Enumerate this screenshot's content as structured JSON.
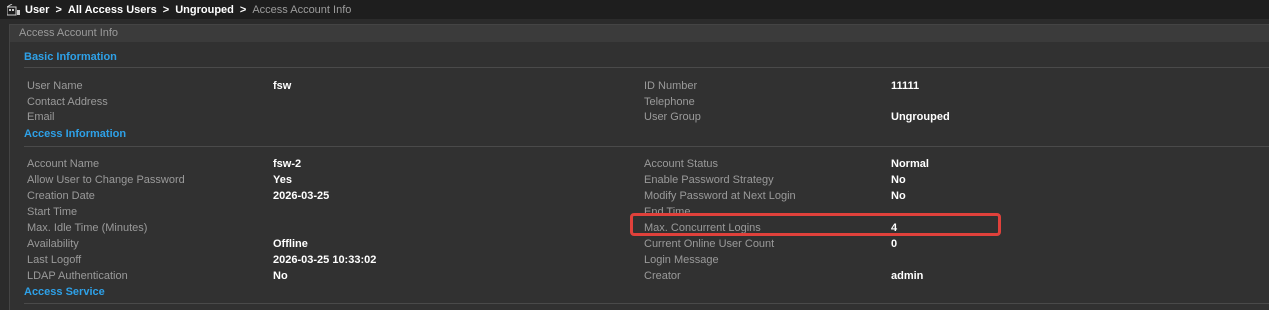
{
  "breadcrumb": {
    "items": [
      "User",
      "All Access Users",
      "Ungrouped",
      "Access Account Info"
    ],
    "separator": ">"
  },
  "panel": {
    "title": "Access Account Info"
  },
  "sections": {
    "basic": "Basic Information",
    "access": "Access Information",
    "service": "Access Service"
  },
  "basic_info": {
    "user_name": {
      "label": "User Name",
      "value": "fsw"
    },
    "contact_address": {
      "label": "Contact Address",
      "value": ""
    },
    "email": {
      "label": "Email",
      "value": ""
    },
    "id_number": {
      "label": "ID Number",
      "value": "11111"
    },
    "telephone": {
      "label": "Telephone",
      "value": ""
    },
    "user_group": {
      "label": "User Group",
      "value": "Ungrouped"
    }
  },
  "access_info": {
    "account_name": {
      "label": "Account Name",
      "value": "fsw-2"
    },
    "allow_change_password": {
      "label": "Allow User to Change Password",
      "value": "Yes"
    },
    "creation_date": {
      "label": "Creation Date",
      "value": "2026-03-25"
    },
    "start_time": {
      "label": "Start Time",
      "value": ""
    },
    "max_idle_time": {
      "label": "Max. Idle Time (Minutes)",
      "value": ""
    },
    "availability": {
      "label": "Availability",
      "value": "Offline"
    },
    "last_logoff": {
      "label": "Last Logoff",
      "value": "2026-03-25 10:33:02"
    },
    "ldap_auth": {
      "label": "LDAP Authentication",
      "value": "No"
    },
    "account_status": {
      "label": "Account Status",
      "value": "Normal"
    },
    "enable_password_strategy": {
      "label": "Enable Password Strategy",
      "value": "No"
    },
    "modify_password_next_login": {
      "label": "Modify Password at Next Login",
      "value": "No"
    },
    "end_time": {
      "label": "End Time",
      "value": ""
    },
    "max_concurrent_logins": {
      "label": "Max. Concurrent Logins",
      "value": "4"
    },
    "current_online_user_count": {
      "label": "Current Online User Count",
      "value": "0"
    },
    "login_message": {
      "label": "Login Message",
      "value": ""
    },
    "creator": {
      "label": "Creator",
      "value": "admin"
    }
  },
  "colors": {
    "background": "#2b2b2b",
    "section_title": "#2ea1e8",
    "highlight_border": "#e0413b"
  }
}
